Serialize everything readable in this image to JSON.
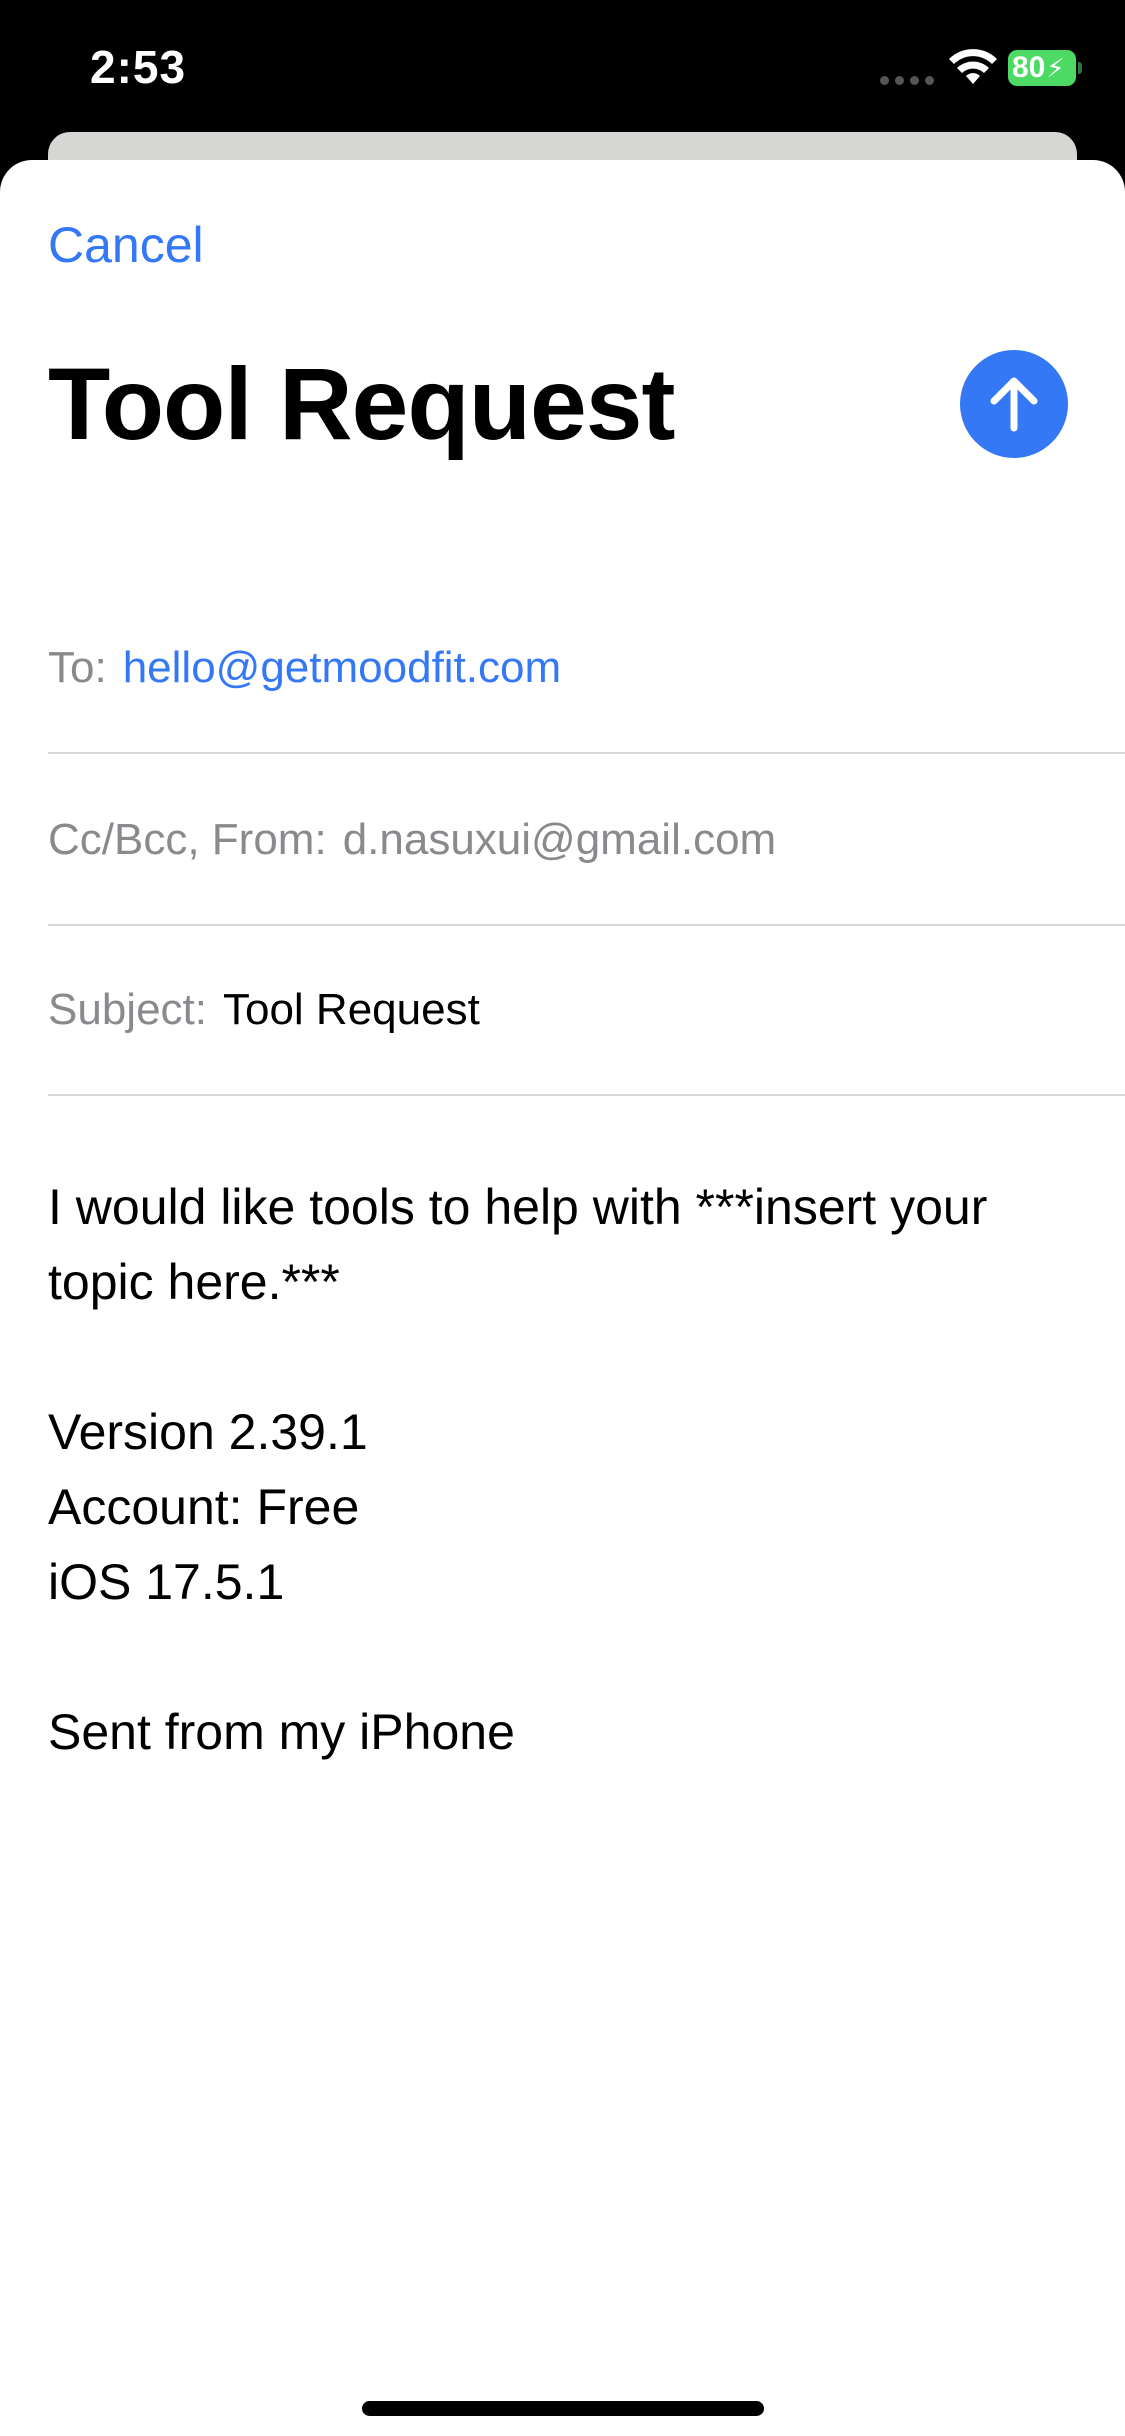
{
  "status_bar": {
    "time": "2:53",
    "battery": "80",
    "icons": [
      "signal-icon",
      "wifi-icon",
      "battery-icon"
    ]
  },
  "compose": {
    "cancel_label": "Cancel",
    "title": "Tool Request",
    "send_icon": "arrow-up-icon",
    "to_label": "To:",
    "to_value": "hello@getmoodfit.com",
    "cc_label": "Cc/Bcc, From:",
    "cc_value": "d.nasuxui@gmail.com",
    "subject_label": "Subject:",
    "subject_value": "Tool Request",
    "body_lines": [
      "I would like tools to help with ***insert your",
      "topic here.***",
      "",
      "Version 2.39.1",
      "Account: Free",
      "iOS 17.5.1",
      "",
      "Sent from my iPhone"
    ]
  },
  "colors": {
    "accent": "#3478f6",
    "battery": "#4cd964",
    "secondary_text": "#8a8a8e"
  }
}
